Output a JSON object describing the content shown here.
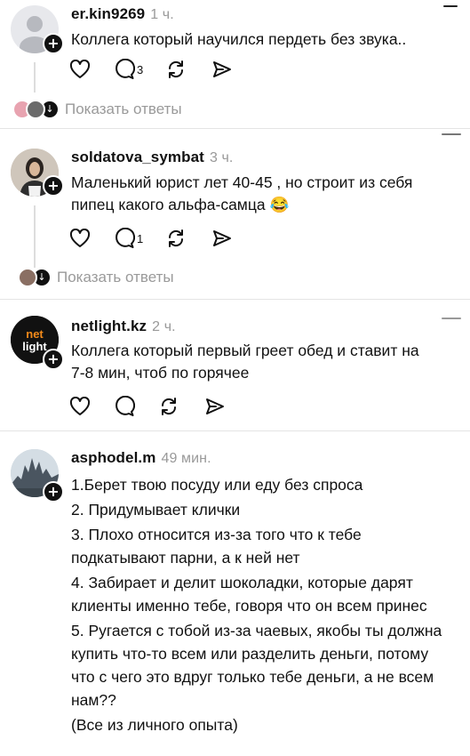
{
  "posts": [
    {
      "username": "er.kin9269",
      "time": "1 ч.",
      "lines": [
        "Коллега который научился пердеть без звука.."
      ],
      "reply_count": "3",
      "show_replies": "Показать ответы"
    },
    {
      "username": "soldatova_symbat",
      "time": "3 ч.",
      "lines": [
        "Маленький юрист лет 40-45 , но строит из себя",
        "пипец какого альфа-самца 😂"
      ],
      "reply_count": "1",
      "show_replies": "Показать ответы"
    },
    {
      "username": "netlight.kz",
      "time": "2 ч.",
      "lines": [
        "Коллега который первый греет обед и ставит на",
        "7-8 мин, чтоб по горячее"
      ],
      "avatar_text": "net light"
    },
    {
      "username": "asphodel.m",
      "time": "49 мин.",
      "lines": [
        "1.Берет твою посуду или еду без спроса",
        "2. Придумывает клички",
        "3. Плохо относится из-за того что к тебе подкатывают парни, а к ней нет",
        "4. Забирает и делит шоколадки, которые дарят клиенты именно тебе, говоря что он всем принес",
        "5. Ругается с тобой из-за чаевых, якобы ты должна купить что-то всем или разделить деньги, потому что с чего это вдруг только тебе деньги, а не всем нам??",
        "(Все из личного опыта)"
      ]
    }
  ],
  "icons": [
    "heart-icon",
    "comment-icon",
    "repost-icon",
    "share-icon",
    "plus-icon",
    "arrow-down-icon"
  ]
}
